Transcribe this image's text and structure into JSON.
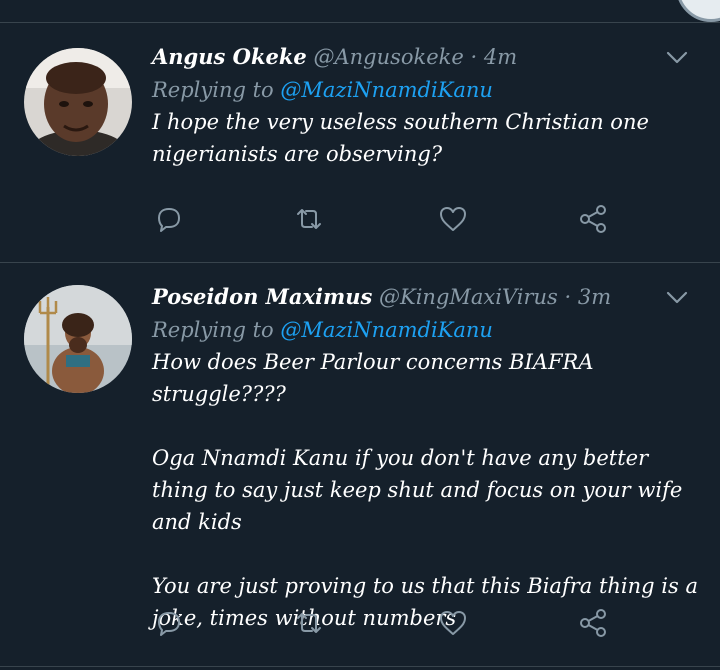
{
  "tweets": [
    {
      "name": "Angus Okeke",
      "handle": "@Angusokeke",
      "separator": "·",
      "time": "4m",
      "replying_prefix": "Replying to",
      "replying_to": "@MaziNnamdiKanu",
      "text": [
        "I hope the very useless southern Christian one nigerianists are observing?"
      ]
    },
    {
      "name": "Poseidon Maximus",
      "handle": "@KingMaxiVirus",
      "separator": "·",
      "time": "3m",
      "replying_prefix": "Replying to",
      "replying_to": "@MaziNnamdiKanu",
      "text": [
        "How does Beer Parlour concerns BIAFRA struggle????",
        "Oga Nnamdi Kanu if you don't have any better thing to say just keep shut and focus on your wife and kids",
        "You are just proving to us that this Biafra thing is a joke, times without numbers"
      ]
    }
  ],
  "icons": {
    "reply": "speech-bubble-icon",
    "retweet": "retweet-icon",
    "like": "heart-icon",
    "share": "share-icon",
    "menu": "chevron-down-icon"
  },
  "colors": {
    "background": "#15202b",
    "divider": "#38444d",
    "secondary_text": "#8899a6",
    "link": "#1da1f2"
  }
}
